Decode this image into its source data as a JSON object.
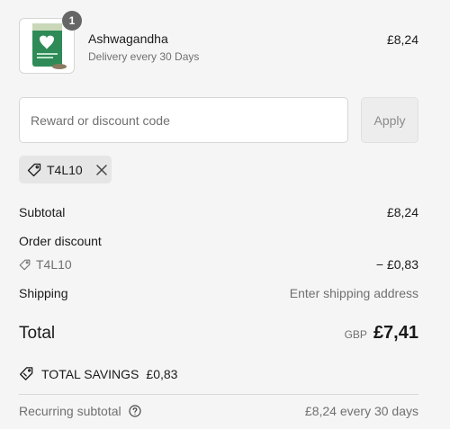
{
  "product": {
    "quantity": "1",
    "name": "Ashwagandha",
    "delivery": "Delivery every 30 Days",
    "price": "£8,24",
    "image_icon": "supplement-pouch-image"
  },
  "discount": {
    "placeholder": "Reward or discount code",
    "apply_label": "Apply",
    "applied_code": "T4L10"
  },
  "summary": {
    "subtotal_label": "Subtotal",
    "subtotal_value": "£8,24",
    "order_discount_label": "Order discount",
    "order_discount_code": "T4L10",
    "order_discount_value": "− £0,83",
    "shipping_label": "Shipping",
    "shipping_value": "Enter shipping address",
    "total_label": "Total",
    "total_currency": "GBP",
    "total_value": "£7,41",
    "savings_label": "TOTAL SAVINGS",
    "savings_value": "£0,83",
    "recurring_label": "Recurring subtotal",
    "recurring_value": "£8,24 every 30 days"
  },
  "colors": {
    "background": "#f5f5f5",
    "badge": "#666666",
    "product_green": "#2e8b57",
    "muted_text": "#707070"
  }
}
